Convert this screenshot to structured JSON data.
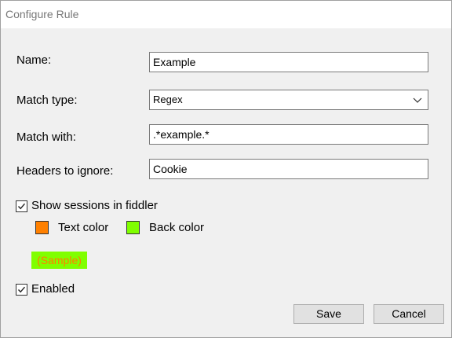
{
  "window": {
    "title": "Configure Rule"
  },
  "form": {
    "name_label": "Name:",
    "name_value": "Example",
    "match_type_label": "Match type:",
    "match_type_value": "Regex",
    "match_with_label": "Match with:",
    "match_with_value": ".*example.*",
    "headers_label": "Headers to ignore:",
    "headers_value": "Cookie"
  },
  "display": {
    "show_sessions_label": "Show sessions in fiddler",
    "show_sessions_checked": true,
    "text_color_label": "Text color",
    "text_color": "#ff8000",
    "back_color_label": "Back color",
    "back_color": "#80ff00",
    "sample_text": "(Sample)"
  },
  "enabled": {
    "label": "Enabled",
    "checked": true
  },
  "buttons": {
    "save_label": "Save",
    "cancel_label": "Cancel"
  }
}
